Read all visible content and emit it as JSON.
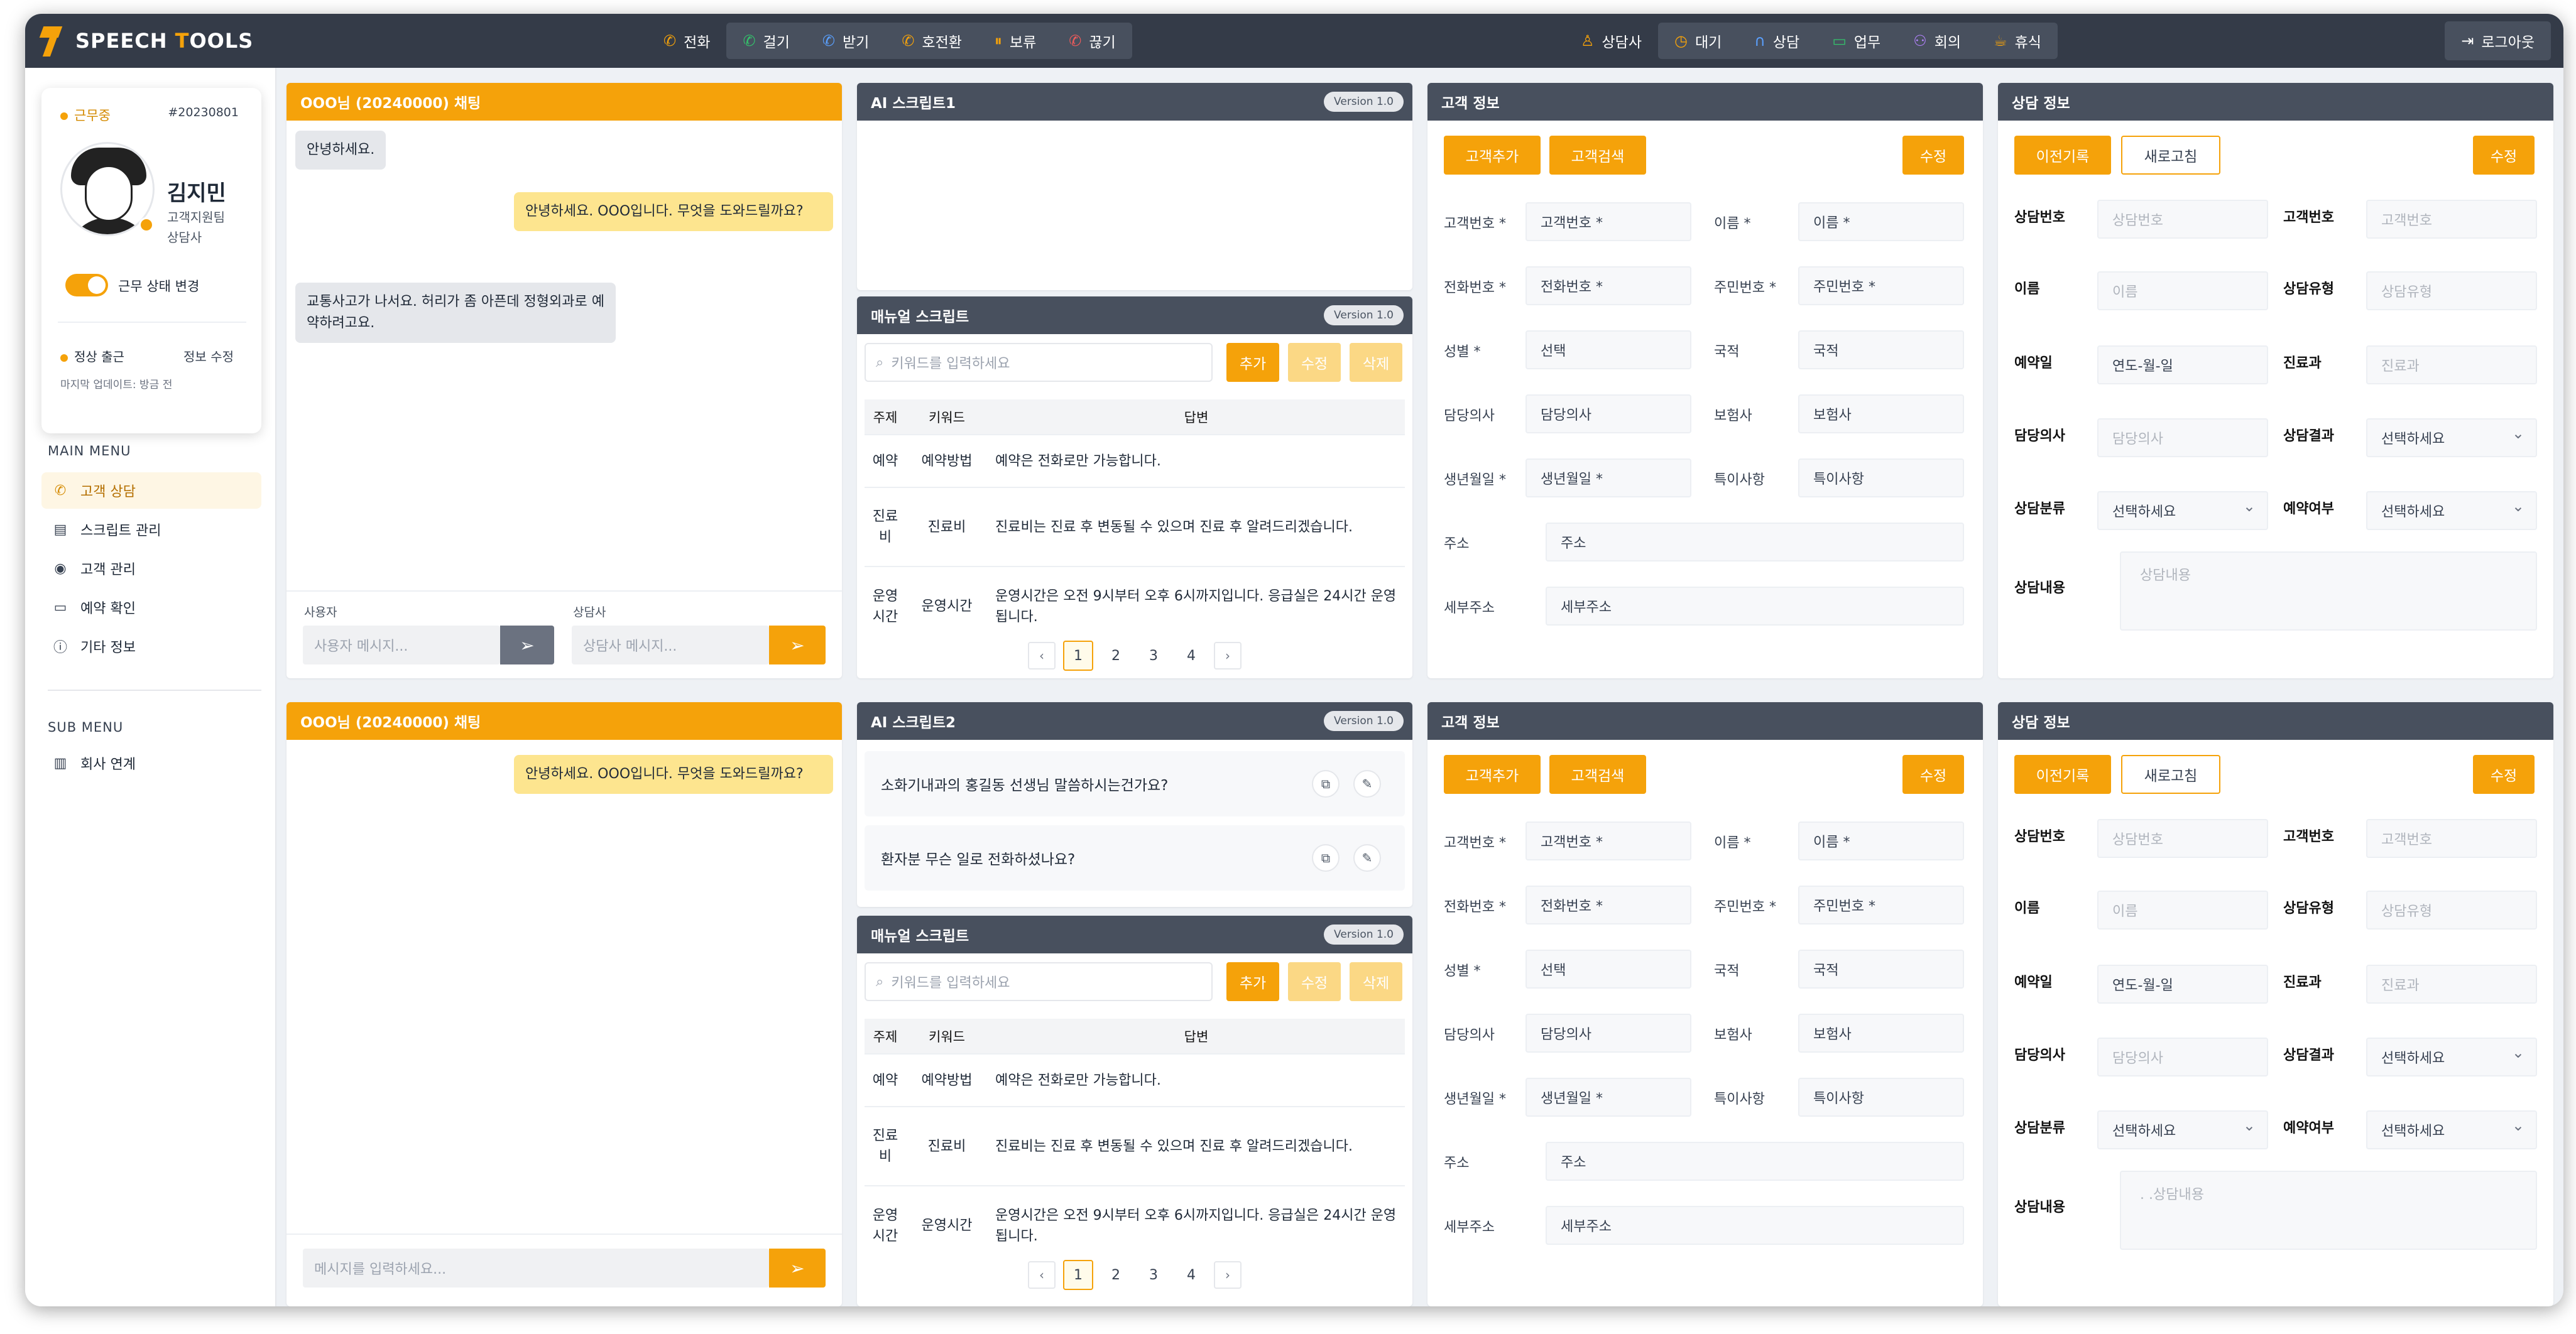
{
  "app": {
    "brand_prefix": "S",
    "brand_word1": "PEECH ",
    "brand_t": "T",
    "brand_word2": "OOLS"
  },
  "topbar": {
    "phone": "전화",
    "call_group": [
      {
        "icon": "phone-outgoing-icon",
        "label": "걸기"
      },
      {
        "icon": "phone-incoming-icon",
        "label": "받기"
      },
      {
        "icon": "phone-transfer-icon",
        "label": "호전환"
      },
      {
        "icon": "pause-icon",
        "label": "보류"
      },
      {
        "icon": "phone-hangup-icon",
        "label": "끊기"
      }
    ],
    "agent": "상담사",
    "status_group": [
      {
        "icon": "clock-icon",
        "label": "대기"
      },
      {
        "icon": "headset-icon",
        "label": "상담"
      },
      {
        "icon": "chat-icon",
        "label": "업무"
      },
      {
        "icon": "users-icon",
        "label": "회의"
      },
      {
        "icon": "coffee-icon",
        "label": "휴식"
      }
    ],
    "logout": "로그아웃"
  },
  "profile": {
    "status": "근무중",
    "emp_no": "#20230801",
    "name": "김지민",
    "team": "고객지원팀",
    "role": "상담사",
    "toggle_label": "근무 상태 변경",
    "shift": "정상 출근",
    "edit": "정보 수정",
    "updated": "마지막 업데이트: 방금 전"
  },
  "menu": {
    "main_title": "MAIN MENU",
    "main": [
      {
        "label": "고객 상담",
        "icon": "phone-icon"
      },
      {
        "label": "스크립트 관리",
        "icon": "document-icon"
      },
      {
        "label": "고객 관리",
        "icon": "user-circle-icon"
      },
      {
        "label": "예약 확인",
        "icon": "monitor-icon"
      },
      {
        "label": "기타 정보",
        "icon": "info-icon"
      }
    ],
    "sub_title": "SUB MENU",
    "sub": [
      {
        "label": "회사 연계",
        "icon": "building-icon"
      }
    ]
  },
  "chat1": {
    "title": "OOO님 (20240000) 채팅",
    "messages": [
      "안녕하세요.",
      "안녕하세요. OOO입니다. 무엇을 도와드릴까요?",
      "교통사고가 나서요. 허리가 좀 아픈데 정형외과로 예약하려고요."
    ],
    "user_label": "사용자",
    "user_placeholder": "사용자 메시지...",
    "agent_label": "상담사",
    "agent_placeholder": "상담사 메시지..."
  },
  "chat2": {
    "title": "OOO님 (20240000) 채팅",
    "messages": [
      "안녕하세요. OOO입니다. 무엇을 도와드릴까요?"
    ],
    "placeholder": "메시지를 입력하세요..."
  },
  "ai1": {
    "title": "AI 스크립트1",
    "version": "Version 1.0"
  },
  "ai2": {
    "title": "AI 스크립트2",
    "version": "Version 1.0",
    "items": [
      "소화기내과의 홍길동 선생님 말씀하시는건가요?",
      "환자분 무슨 일로 전화하셨나요?"
    ]
  },
  "manual": {
    "title": "매뉴얼 스크립트",
    "version": "Version 1.0",
    "search_placeholder": "키워드를 입력하세요",
    "add": "추가",
    "edit": "수정",
    "delete": "삭제",
    "columns": [
      "주제",
      "키워드",
      "답변"
    ],
    "rows": [
      [
        "예약",
        "예약방법",
        "예약은 전화로만 가능합니다."
      ],
      [
        "진료비",
        "진료비",
        "진료비는 진료 후 변동될 수 있으며 진료 후 알려드리겠습니다."
      ],
      [
        "운영시간",
        "운영시간",
        "운영시간은 오전 9시부터 오후 6시까지입니다. 응급실은 24시간 운영됩니다."
      ]
    ],
    "pages": [
      "1",
      "2",
      "3",
      "4"
    ]
  },
  "customer": {
    "title": "고객 정보",
    "add": "고객추가",
    "search": "고객검색",
    "edit": "수정",
    "fields": {
      "cust_no": "고객번호 *",
      "name": "이름 *",
      "phone": "전화번호 *",
      "rrn": "주민번호 *",
      "gender": "성별 *",
      "gender_val": "선택",
      "nation": "국적",
      "doctor": "담당의사",
      "insurer": "보험사",
      "birth": "생년월일 *",
      "special": "특이사항",
      "address": "주소",
      "address2": "세부주소"
    }
  },
  "consult": {
    "title": "상담 정보",
    "history": "이전기록",
    "refresh": "새로고침",
    "edit": "수정",
    "fields": {
      "no": "상담번호",
      "cust_no": "고객번호",
      "name": "이름",
      "type": "상담유형",
      "date": "예약일",
      "date_val": "연도-월-일",
      "dept": "진료과",
      "doctor": "담당의사",
      "result": "상담결과",
      "category": "상담분류",
      "reserve": "예약여부",
      "select": "선택하세요",
      "content": "상담내용",
      "content_ph2": ". .상담내용"
    }
  }
}
